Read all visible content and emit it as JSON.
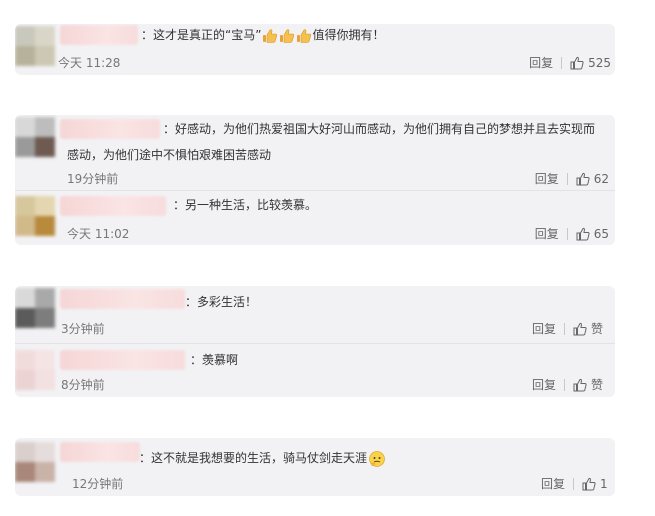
{
  "colors": {
    "card_bg": "#f2f2f5",
    "text": "#333333",
    "meta": "#777777",
    "name_blur": "#f6d6d6"
  },
  "comments": [
    {
      "text": "：这才是真正的“宝马”",
      "text_tail": "值得你拥有！",
      "time": "今天 11:28",
      "reply": "回复",
      "likes": "525",
      "icons": [
        "thumbs-up-emoji",
        "thumbs-up-emoji",
        "thumbs-up-emoji"
      ]
    },
    {
      "line1": "：好感动，为他们热爱祖国大好河山而感动，为他们拥有自己的梦想并且去实现而",
      "line2": "感动，为他们途中不惧怕艰难困苦感动",
      "time": "19分钟前",
      "reply": "回复",
      "likes": "62",
      "reply_item": {
        "text": "：另一种生活，比较羡慕。",
        "time": "今天 11:02",
        "reply": "回复",
        "likes": "65"
      }
    },
    {
      "text": "：多彩生活！",
      "time": "3分钟前",
      "reply": "回复",
      "likes": "赞",
      "reply_item": {
        "text": "：羡慕啊",
        "time": "8分钟前",
        "reply": "回复",
        "likes": "赞"
      }
    },
    {
      "text": "：这不就是我想要的生活，骑马仗剑走天涯",
      "time": "12分钟前",
      "reply": "回复",
      "likes": "1",
      "icons": [
        "thinking-face-emoji"
      ]
    }
  ]
}
